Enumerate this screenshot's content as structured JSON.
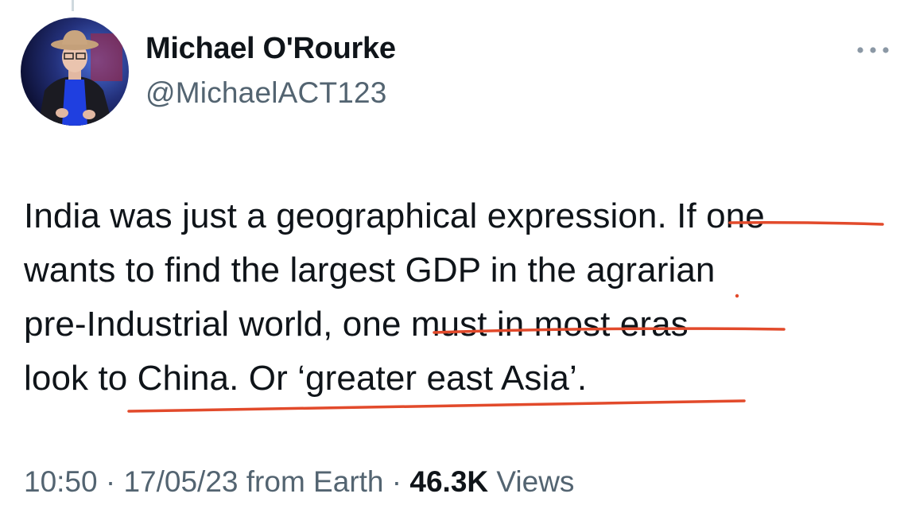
{
  "author": {
    "display_name": "Michael O'Rourke",
    "handle": "@MichaelACT123"
  },
  "tweet": {
    "text": "India was just a geographical expression. If one\nwants to find the largest GDP in the agrarian\npre-Industrial world, one must in most eras\nlook to China. Or ‘greater east Asia’.",
    "timestamp": "10:50 · 17/05/23",
    "source": "from Earth",
    "separator": "·",
    "views_count": "46.3K",
    "views_label": "Views"
  },
  "icons": {
    "more": "more-horizontal-icon",
    "thread": "thread-connector"
  },
  "colors": {
    "text": "#0f1419",
    "secondary": "#536471",
    "annotation": "#e24a2b"
  }
}
